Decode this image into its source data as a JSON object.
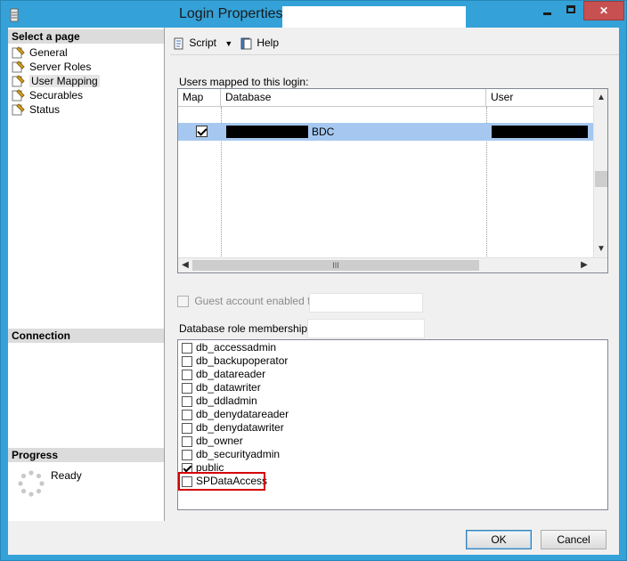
{
  "window": {
    "title": "Login Properties -"
  },
  "left_pane": {
    "select_page_header": "Select a page",
    "items": [
      {
        "label": "General"
      },
      {
        "label": "Server Roles"
      },
      {
        "label": "User Mapping",
        "selected": true
      },
      {
        "label": "Securables"
      },
      {
        "label": "Status"
      }
    ],
    "connection_header": "Connection",
    "progress_header": "Progress",
    "progress_status": "Ready"
  },
  "toolbar": {
    "script_label": "Script",
    "help_label": "Help"
  },
  "users_mapped": {
    "label": "Users mapped to this login:",
    "columns": [
      "Map",
      "Database",
      "User"
    ],
    "rows": [
      {
        "map_checked": true,
        "database_suffix": "BDC"
      }
    ],
    "hscroll_grip": "III"
  },
  "guest": {
    "label": "Guest account enabled for:",
    "checked": false,
    "enabled": false
  },
  "roles": {
    "label": "Database role membership for:",
    "items": [
      {
        "label": "db_accessadmin",
        "checked": false
      },
      {
        "label": "db_backupoperator",
        "checked": false
      },
      {
        "label": "db_datareader",
        "checked": false
      },
      {
        "label": "db_datawriter",
        "checked": false
      },
      {
        "label": "db_ddladmin",
        "checked": false
      },
      {
        "label": "db_denydatareader",
        "checked": false
      },
      {
        "label": "db_denydatawriter",
        "checked": false
      },
      {
        "label": "db_owner",
        "checked": false
      },
      {
        "label": "db_securityadmin",
        "checked": false
      },
      {
        "label": "public",
        "checked": true
      },
      {
        "label": "SPDataAccess",
        "checked": false,
        "highlighted": true
      }
    ],
    "highlight_color": "#d40000"
  },
  "buttons": {
    "ok_label": "OK",
    "cancel_label": "Cancel"
  },
  "colors": {
    "window_frame": "#34a2d8",
    "close_button": "#c75050",
    "selected_row": "#a6c8f0"
  }
}
